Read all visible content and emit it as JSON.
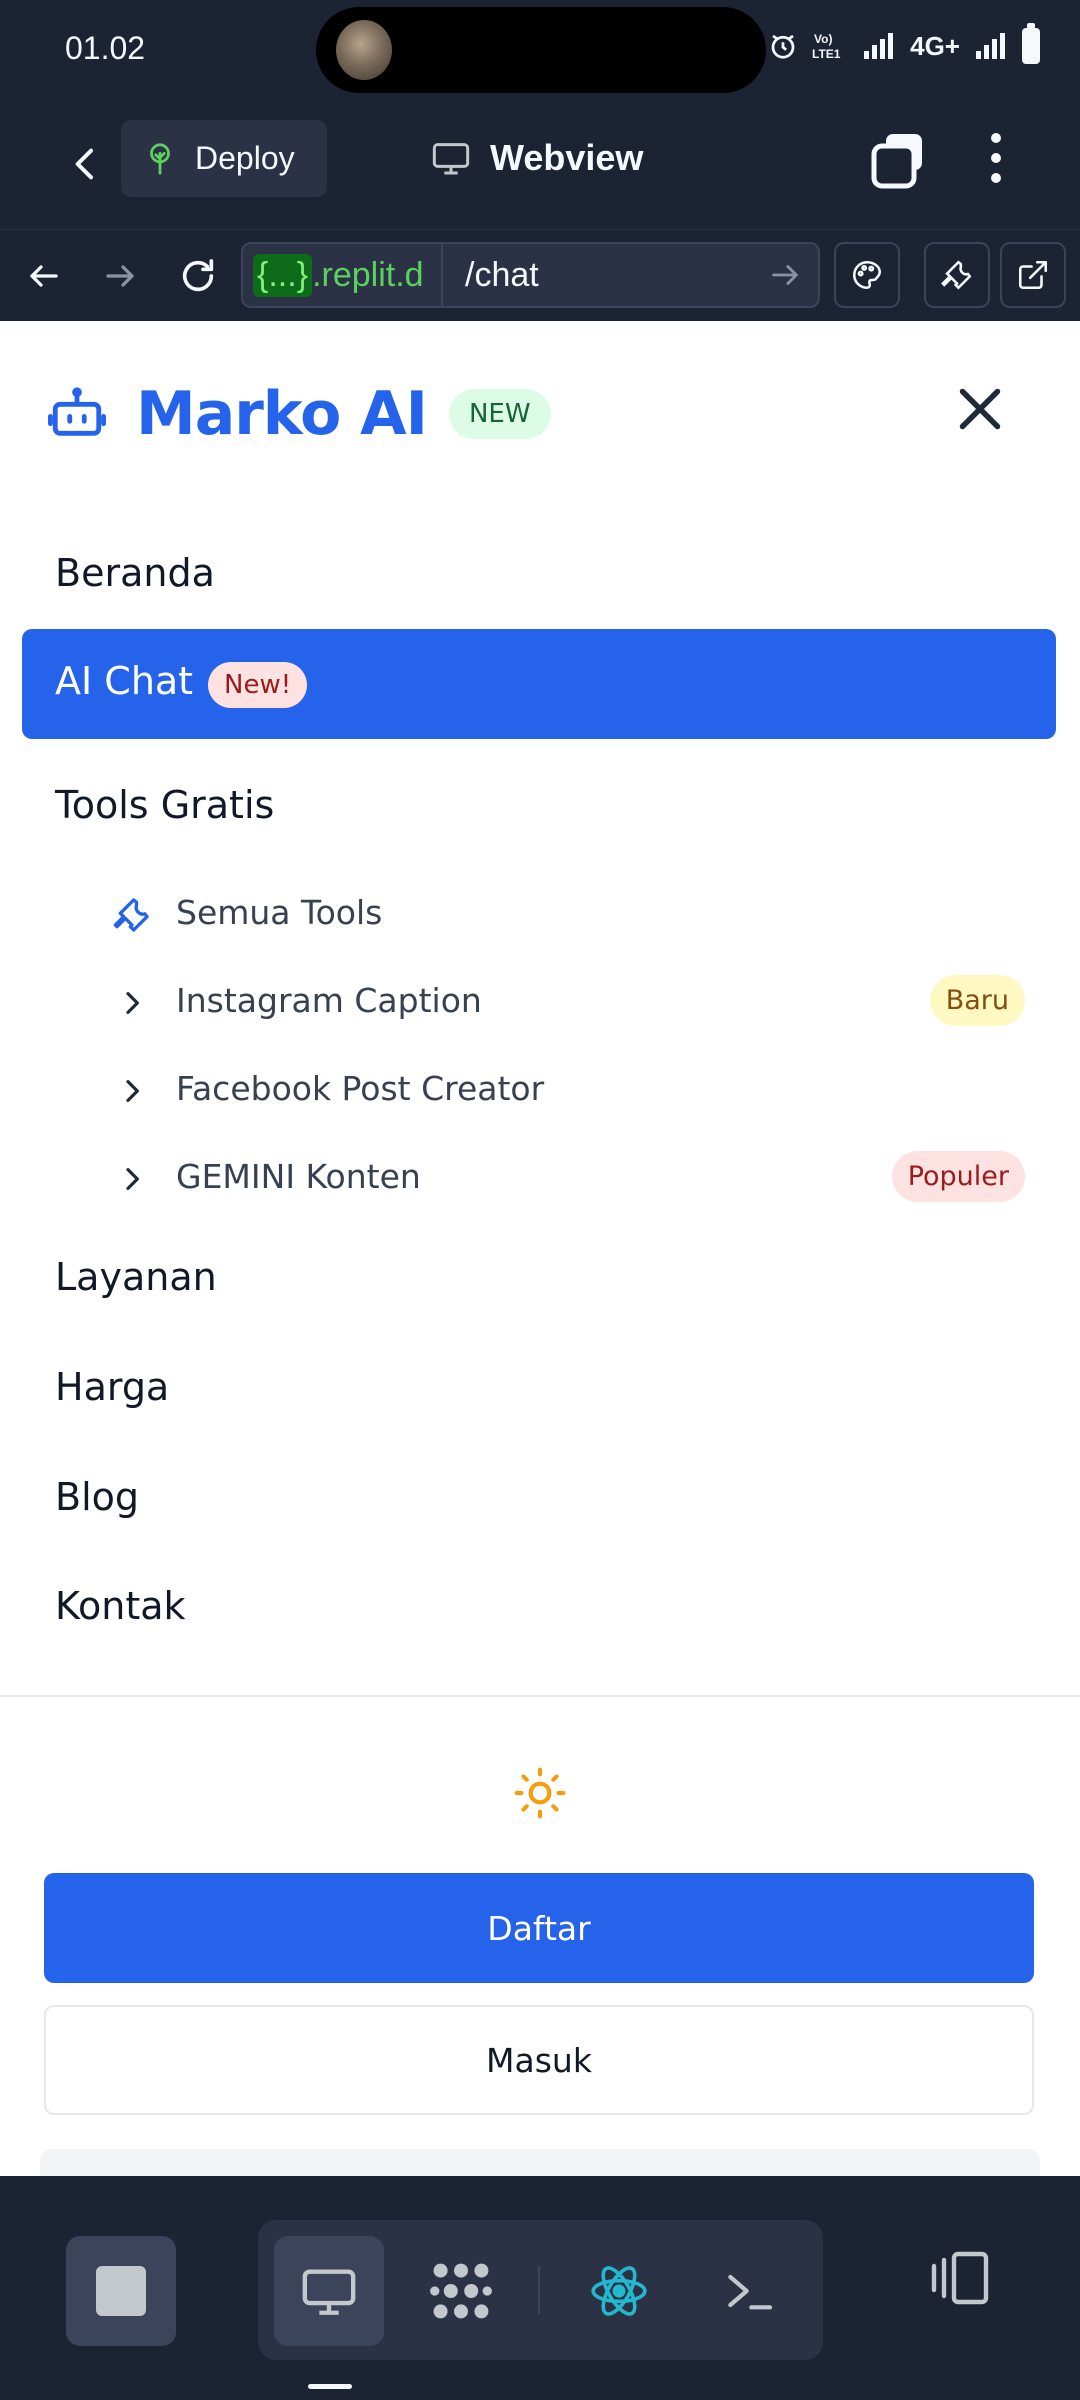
{
  "status_bar": {
    "time": "01.02",
    "network_label": "4G+",
    "volte_label": "Vo LTE1"
  },
  "header": {
    "deploy_label": "Deploy",
    "webview_label": "Webview"
  },
  "url_bar": {
    "domain_highlight": "{...}",
    "domain_text": ".replit.d",
    "path": "/chat"
  },
  "site": {
    "brand_name": "Marko AI",
    "brand_badge": "NEW",
    "menu": {
      "home": "Beranda",
      "ai_chat": "AI Chat",
      "ai_chat_badge": "New!",
      "tools_gratis": "Tools Gratis",
      "sub_items": [
        {
          "label": "Semua Tools",
          "icon": "wrench-icon",
          "badge": ""
        },
        {
          "label": "Instagram Caption",
          "icon": "chevron-right-icon",
          "badge": "Baru"
        },
        {
          "label": "Facebook Post Creator",
          "icon": "chevron-right-icon",
          "badge": ""
        },
        {
          "label": "GEMINI Konten",
          "icon": "chevron-right-icon",
          "badge": "Populer"
        }
      ],
      "layanan": "Layanan",
      "harga": "Harga",
      "blog": "Blog",
      "kontak": "Kontak"
    },
    "register_label": "Daftar",
    "login_label": "Masuk"
  },
  "colors": {
    "replit_bg": "#1c2333",
    "primary_blue": "#2563eb",
    "url_green": "#5bd15d"
  }
}
